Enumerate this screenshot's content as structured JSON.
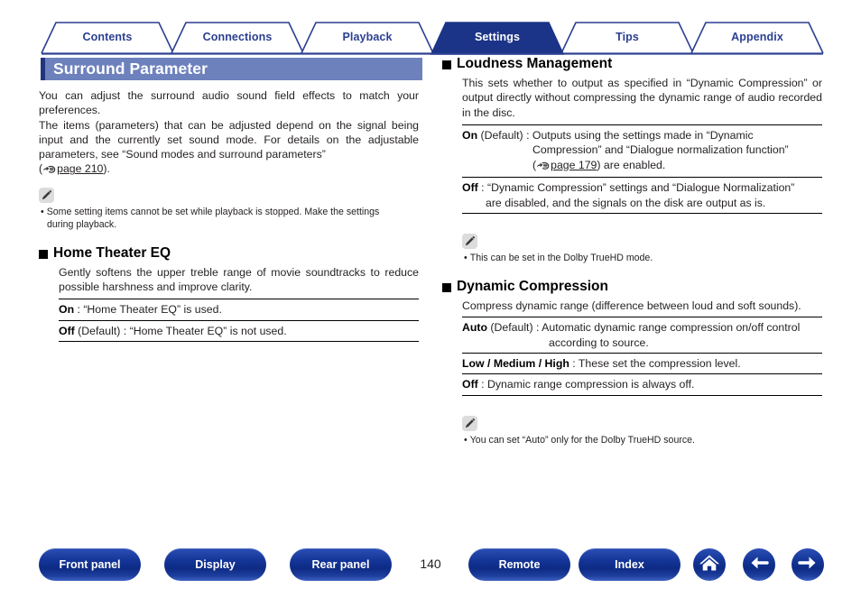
{
  "tabs": [
    {
      "label": "Contents",
      "active": false
    },
    {
      "label": "Connections",
      "active": false
    },
    {
      "label": "Playback",
      "active": false
    },
    {
      "label": "Settings",
      "active": true
    },
    {
      "label": "Tips",
      "active": false
    },
    {
      "label": "Appendix",
      "active": false
    }
  ],
  "banner": {
    "title": "Surround Parameter"
  },
  "left": {
    "intro_1": "You can adjust the surround audio sound field effects to match your preferences.",
    "intro_2": "The items (parameters) that can be adjusted depend on the signal being input and the currently set sound mode. For details on the adjustable parameters, see “Sound modes and surround parameters”",
    "intro_link_open": "(",
    "intro_link_text": "page 210",
    "intro_link_close": ").",
    "note_1": {
      "icon": "pencil-icon",
      "bullet": "•",
      "line1": "Some setting items cannot be set while playback is stopped. Make the settings",
      "line2": "during playback."
    },
    "section": {
      "heading": "Home Theater EQ",
      "desc": "Gently softens the upper treble range of movie soundtracks to reduce possible harshness and improve clarity.",
      "rows": [
        {
          "key": "On",
          "default": "",
          "text": " : “Home Theater EQ” is used."
        },
        {
          "key": "Off",
          "default": " (Default)",
          "text": " : “Home Theater EQ” is not used."
        }
      ]
    }
  },
  "right": {
    "section1": {
      "heading": "Loudness Management",
      "desc": "This sets whether to output as specified in “Dynamic Compression” or output directly without compressing the dynamic range of audio recorded in the disc.",
      "row_on": {
        "key": "On",
        "default": " (Default)",
        "sep": " : ",
        "line1": "Outputs   using   the   settings   made   in   “Dynamic",
        "line2": "Compression”  and  “Dialogue  normalization  function”",
        "line3_open": "(",
        "line3_link": "page 179",
        "line3_close": ") are enabled."
      },
      "row_off": {
        "key": "Off",
        "sep": " : ",
        "line1": "“Dynamic Compression” settings and “Dialogue Normalization”",
        "line2": "are disabled, and the signals on the disk are output as is."
      }
    },
    "note_2": {
      "icon": "pencil-icon",
      "bullet": "•",
      "line1": "This can be set in the Dolby TrueHD mode."
    },
    "section2": {
      "heading": "Dynamic Compression",
      "desc": "Compress dynamic range (difference between loud and soft sounds).",
      "row_auto": {
        "key": "Auto",
        "default": " (Default)",
        "sep": " : ",
        "line1": "Automatic  dynamic  range  compression  on/off  control",
        "line2": "according to source."
      },
      "row_levels": {
        "key": "Low / Medium / High",
        "text": " : These set the compression level."
      },
      "row_off": {
        "key": "Off",
        "text": " : Dynamic range compression is always off."
      }
    },
    "note_3": {
      "icon": "pencil-icon",
      "bullet": "•",
      "line1": "You can set “Auto” only for the Dolby TrueHD source."
    }
  },
  "footer": {
    "buttons": [
      {
        "label": "Front panel"
      },
      {
        "label": "Display"
      },
      {
        "label": "Rear panel"
      },
      {
        "label": "Remote"
      },
      {
        "label": "Index"
      }
    ],
    "page_number": "140",
    "icons": [
      {
        "name": "home-icon"
      },
      {
        "name": "arrow-left-icon"
      },
      {
        "name": "arrow-right-icon"
      }
    ]
  },
  "colors": {
    "tab_blue": "#2b3f91",
    "active_tab": "#1b3487",
    "banner_fill": "#6d81bd",
    "banner_bar": "#23347e",
    "button_blue": "#143597"
  }
}
